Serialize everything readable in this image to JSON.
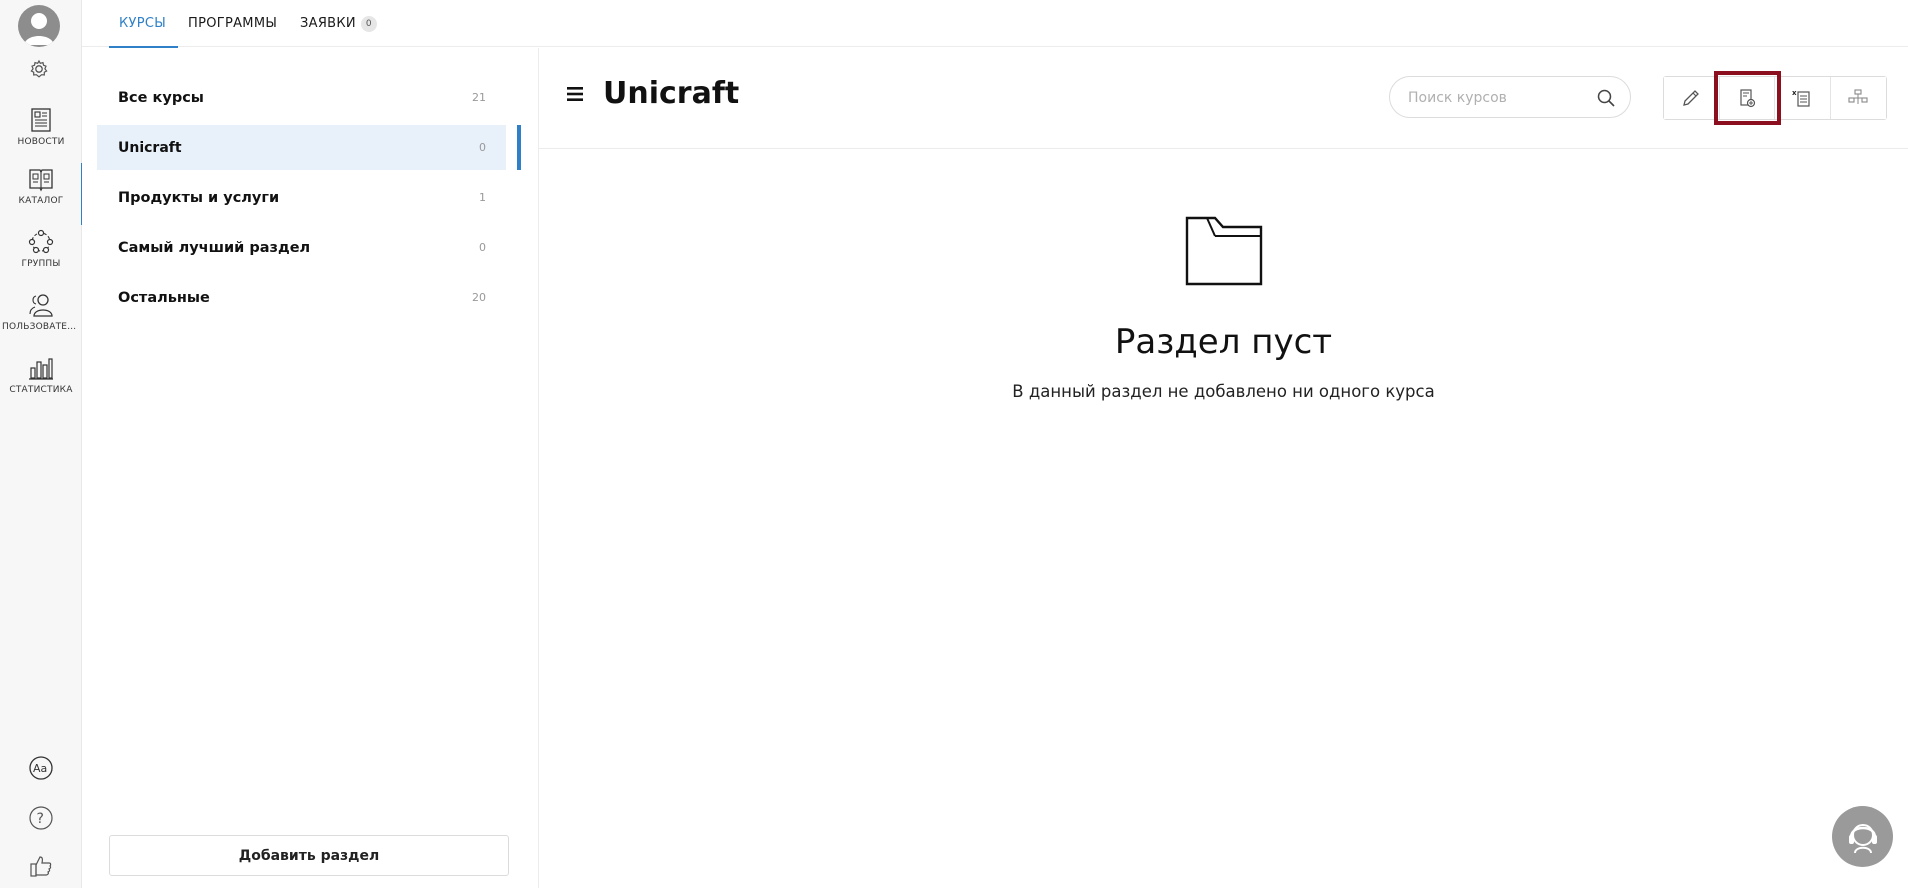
{
  "rail": {
    "items": [
      {
        "label": "НОВОСТИ",
        "icon": "news-icon"
      },
      {
        "label": "КАТАЛОГ",
        "icon": "catalog-icon"
      },
      {
        "label": "ГРУППЫ",
        "icon": "groups-icon"
      },
      {
        "label": "ПОЛЬЗОВАТЕЛИ",
        "icon": "users-icon"
      },
      {
        "label": "СТАТИСТИКА",
        "icon": "statistics-icon"
      }
    ],
    "bottom_icons": [
      "language-icon",
      "help-icon",
      "thumbs-up-icon"
    ]
  },
  "tabs": [
    {
      "label": "КУРСЫ"
    },
    {
      "label": "ПРОГРАММЫ"
    },
    {
      "label": "ЗАЯВКИ",
      "badge": "0"
    }
  ],
  "sections": [
    {
      "name": "Все курсы",
      "count": "21"
    },
    {
      "name": "Unicraft",
      "count": "0"
    },
    {
      "name": "Продукты и услуги",
      "count": "1"
    },
    {
      "name": "Самый лучший раздел",
      "count": "0"
    },
    {
      "name": "Остальные",
      "count": "20"
    }
  ],
  "add_section_label": "Добавить раздел",
  "main": {
    "title": "Unicraft",
    "search_placeholder": "Поиск курсов",
    "toolbar": [
      "edit-icon",
      "import-course-icon",
      "excel-export-icon",
      "structure-icon"
    ],
    "empty": {
      "title": "Раздел пуст",
      "text": "В данный раздел не добавлено ни одного курса"
    }
  },
  "colors": {
    "accent": "#2f80c6",
    "highlight_box": "#8b0f1e",
    "selected_bg": "#e8f1fa"
  }
}
